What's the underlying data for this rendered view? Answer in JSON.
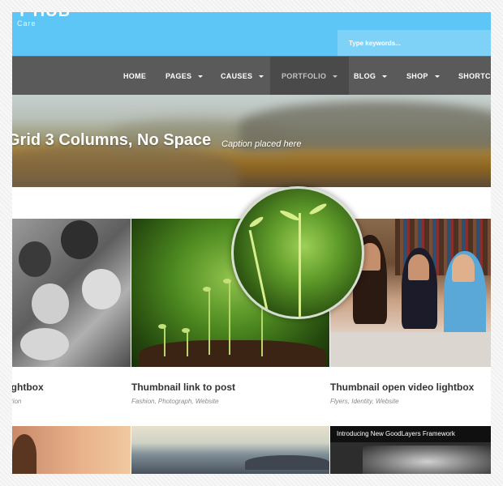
{
  "header": {
    "logo_text": "T HUB",
    "tagline": "Care",
    "search_placeholder": "Type keywords..."
  },
  "nav": {
    "items": [
      {
        "label": "HOME"
      },
      {
        "label": "PAGES"
      },
      {
        "label": "CAUSES"
      },
      {
        "label": "PORTFOLIO"
      },
      {
        "label": "BLOG"
      },
      {
        "label": "SHOP"
      },
      {
        "label": "SHORTCO"
      }
    ],
    "active_item": "PORTFOLIO"
  },
  "banner": {
    "title": "Grid 3 Columns, No Space",
    "caption": "Caption placed here"
  },
  "portfolio": {
    "items": [
      {
        "title": "lightbox",
        "tags": "ation"
      },
      {
        "title": "Thumbnail link to post",
        "tags": "Fashion, Photograph, Website"
      },
      {
        "title": "Thumbnail open video lightbox",
        "tags": "Flyers, Identity, Website"
      }
    ],
    "bottom_video_title": "Introducing New GoodLayers Framework"
  },
  "colors": {
    "header_bg": "#5ec6f6",
    "nav_bg": "#5a5a5a",
    "nav_active_bg": "#4a4a4a"
  }
}
